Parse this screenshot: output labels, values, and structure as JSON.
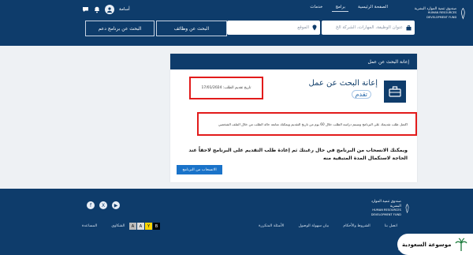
{
  "header": {
    "logo_ar": "صندوق تنمية الموارد البشرية",
    "logo_en": "HUMAN RESOURCES DEVELOPMENT FUND",
    "nav": [
      "الصفحة الرئيسية",
      "برامج",
      "خدمات"
    ],
    "user_name": "أسامة",
    "job_search_placeholder": "عنوان الوظيفة، المهارات، الشركة الخ",
    "location_placeholder": "الموقع",
    "btn_search_jobs": "البحث عن وظائف",
    "btn_search_programs": "البحث عن برنامج دعم"
  },
  "panel": {
    "header": "إعانة البحث عن عمل",
    "title": "إعانة البحث عن عمل",
    "tag": "تقدم",
    "submit_date": "تاريخ تقديم الطلب: 17/01/2024",
    "info": "اكتمل طلب تقديمك على البرنامج وسيتم دراسة الطلب خلال 60 يوم من تاريخ التقديم ويمكنك متابعة حالة الطلب من خلال الملف الشخصي",
    "warning": "ويمكنك الانسحاب من البرنامج في حال رغبتك ثم إعادة طلب التقديم على البرنامج لاحقاً عند الحاجة لاستكمال المدة المتبقية منه",
    "withdraw_btn": "الانسحاب من البرنامج"
  },
  "footer": {
    "logo_ar": "صندوق تنمية الموارد البشرية",
    "logo_en": "HUMAN RESOURCES DEVELOPMENT FUND",
    "links": [
      "اتصل بنا",
      "الشروط والأحكام",
      "بيان سهولة الوصول",
      "الأسئلة المتكررة"
    ],
    "links_left": [
      "الشكاوى",
      "المساعدة"
    ],
    "a11y": [
      "B",
      "Y",
      "A",
      "A"
    ],
    "bottom": "الجهات الاجتماعية",
    "badge": "موسوعة السعودية"
  }
}
